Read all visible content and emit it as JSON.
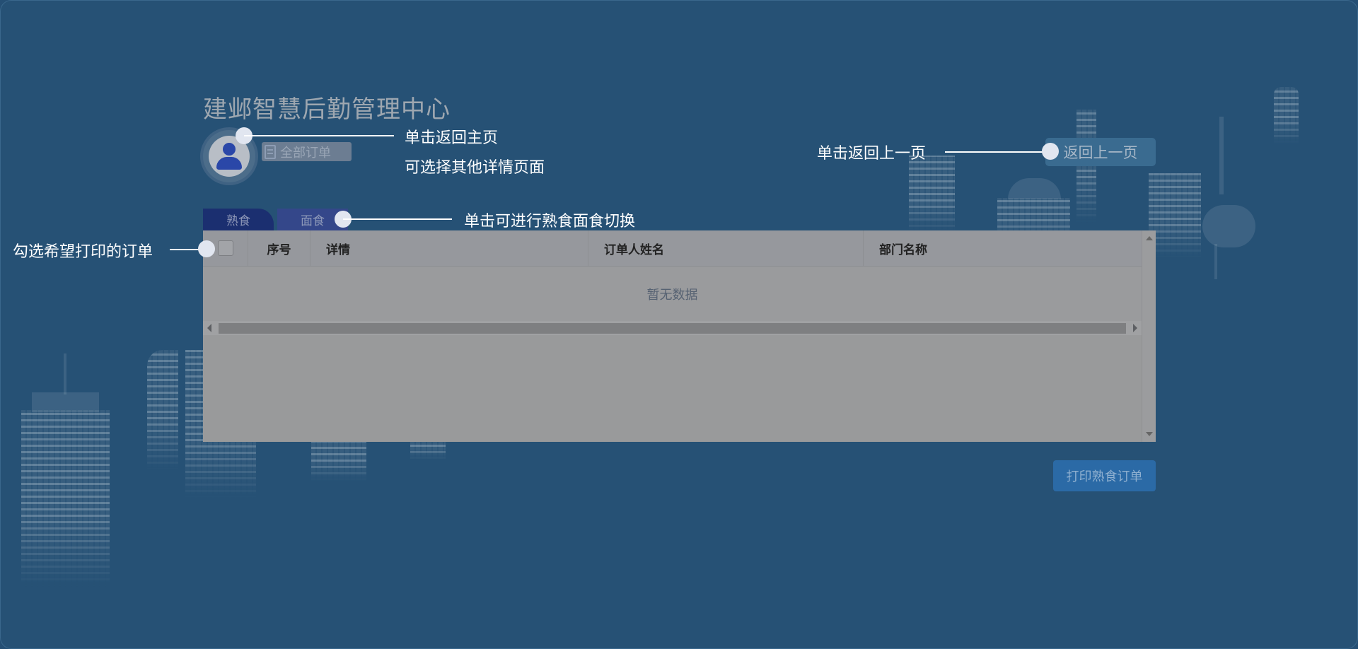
{
  "app": {
    "title": "建邺智慧后勤管理中心"
  },
  "header": {
    "all_orders_label": "全部订单",
    "back_button_label": "返回上一页"
  },
  "tabs": [
    {
      "label": "熟食",
      "active": true
    },
    {
      "label": "面食",
      "active": false
    }
  ],
  "table": {
    "columns": [
      "",
      "序号",
      "详情",
      "订单人姓名",
      "部门名称"
    ],
    "rows": [],
    "empty_text": "暂无数据"
  },
  "actions": {
    "print_button_label": "打印熟食订单"
  },
  "annotations": {
    "home": "单击返回主页",
    "other_pages": "可选择其他详情页面",
    "back": "单击返回上一页",
    "switch_tabs": "单击可进行熟食面食切换",
    "select_orders": "勾选希望打印的订单"
  },
  "colors": {
    "background": "#265175",
    "tab_active": "#1b2f70",
    "tab_inactive": "#34478a",
    "print_button": "#2b6aa6",
    "annotation_dot": "#e1e6f0"
  },
  "icons": {
    "avatar": "user-avatar-icon",
    "all_orders": "document-icon"
  }
}
